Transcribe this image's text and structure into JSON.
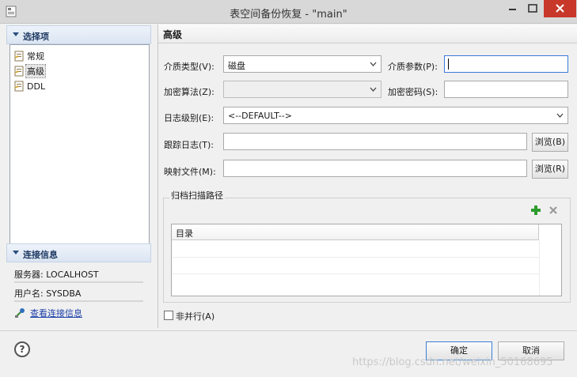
{
  "window": {
    "title": "表空间备份恢复 - \"main\""
  },
  "left_panel": {
    "options_header": "选择项",
    "tree_items": [
      {
        "label": "常规",
        "icon": "page-icon"
      },
      {
        "label": "高级",
        "icon": "page-icon",
        "selected": true
      },
      {
        "label": "DDL",
        "icon": "page-icon"
      }
    ],
    "connection_header": "连接信息",
    "server_label": "服务器: LOCALHOST",
    "user_label": "用户名: SYSDBA",
    "view_connection_link": "查看连接信息"
  },
  "form": {
    "section_title": "高级",
    "media_type_label": "介质类型(V):",
    "media_type_value": "磁盘",
    "media_param_label": "介质参数(P):",
    "media_param_value": "",
    "encrypt_algo_label": "加密算法(Z):",
    "encrypt_algo_value": "",
    "encrypt_pwd_label": "加密密码(S):",
    "encrypt_pwd_value": "",
    "log_level_label": "日志级别(E):",
    "log_level_value": "<--DEFAULT-->",
    "trace_log_label": "跟踪日志(T):",
    "trace_log_value": "",
    "trace_browse_label": "浏览(B)",
    "map_file_label": "映射文件(M):",
    "map_file_value": "",
    "map_browse_label": "浏览(R)",
    "archive_group_title": "归档扫描路径",
    "table_header_dir": "目录",
    "non_parallel_label": "非并行(A)",
    "non_parallel_checked": false
  },
  "footer": {
    "help_symbol": "?",
    "ok_label": "确定",
    "cancel_label": "取消"
  },
  "watermark": "https://blog.csdn.net/weixin_50168695",
  "colors": {
    "close_button": "#c7382b",
    "add_icon": "#2e9c2e",
    "link": "#1c3fa8",
    "focus_border": "#3a7ad9"
  }
}
